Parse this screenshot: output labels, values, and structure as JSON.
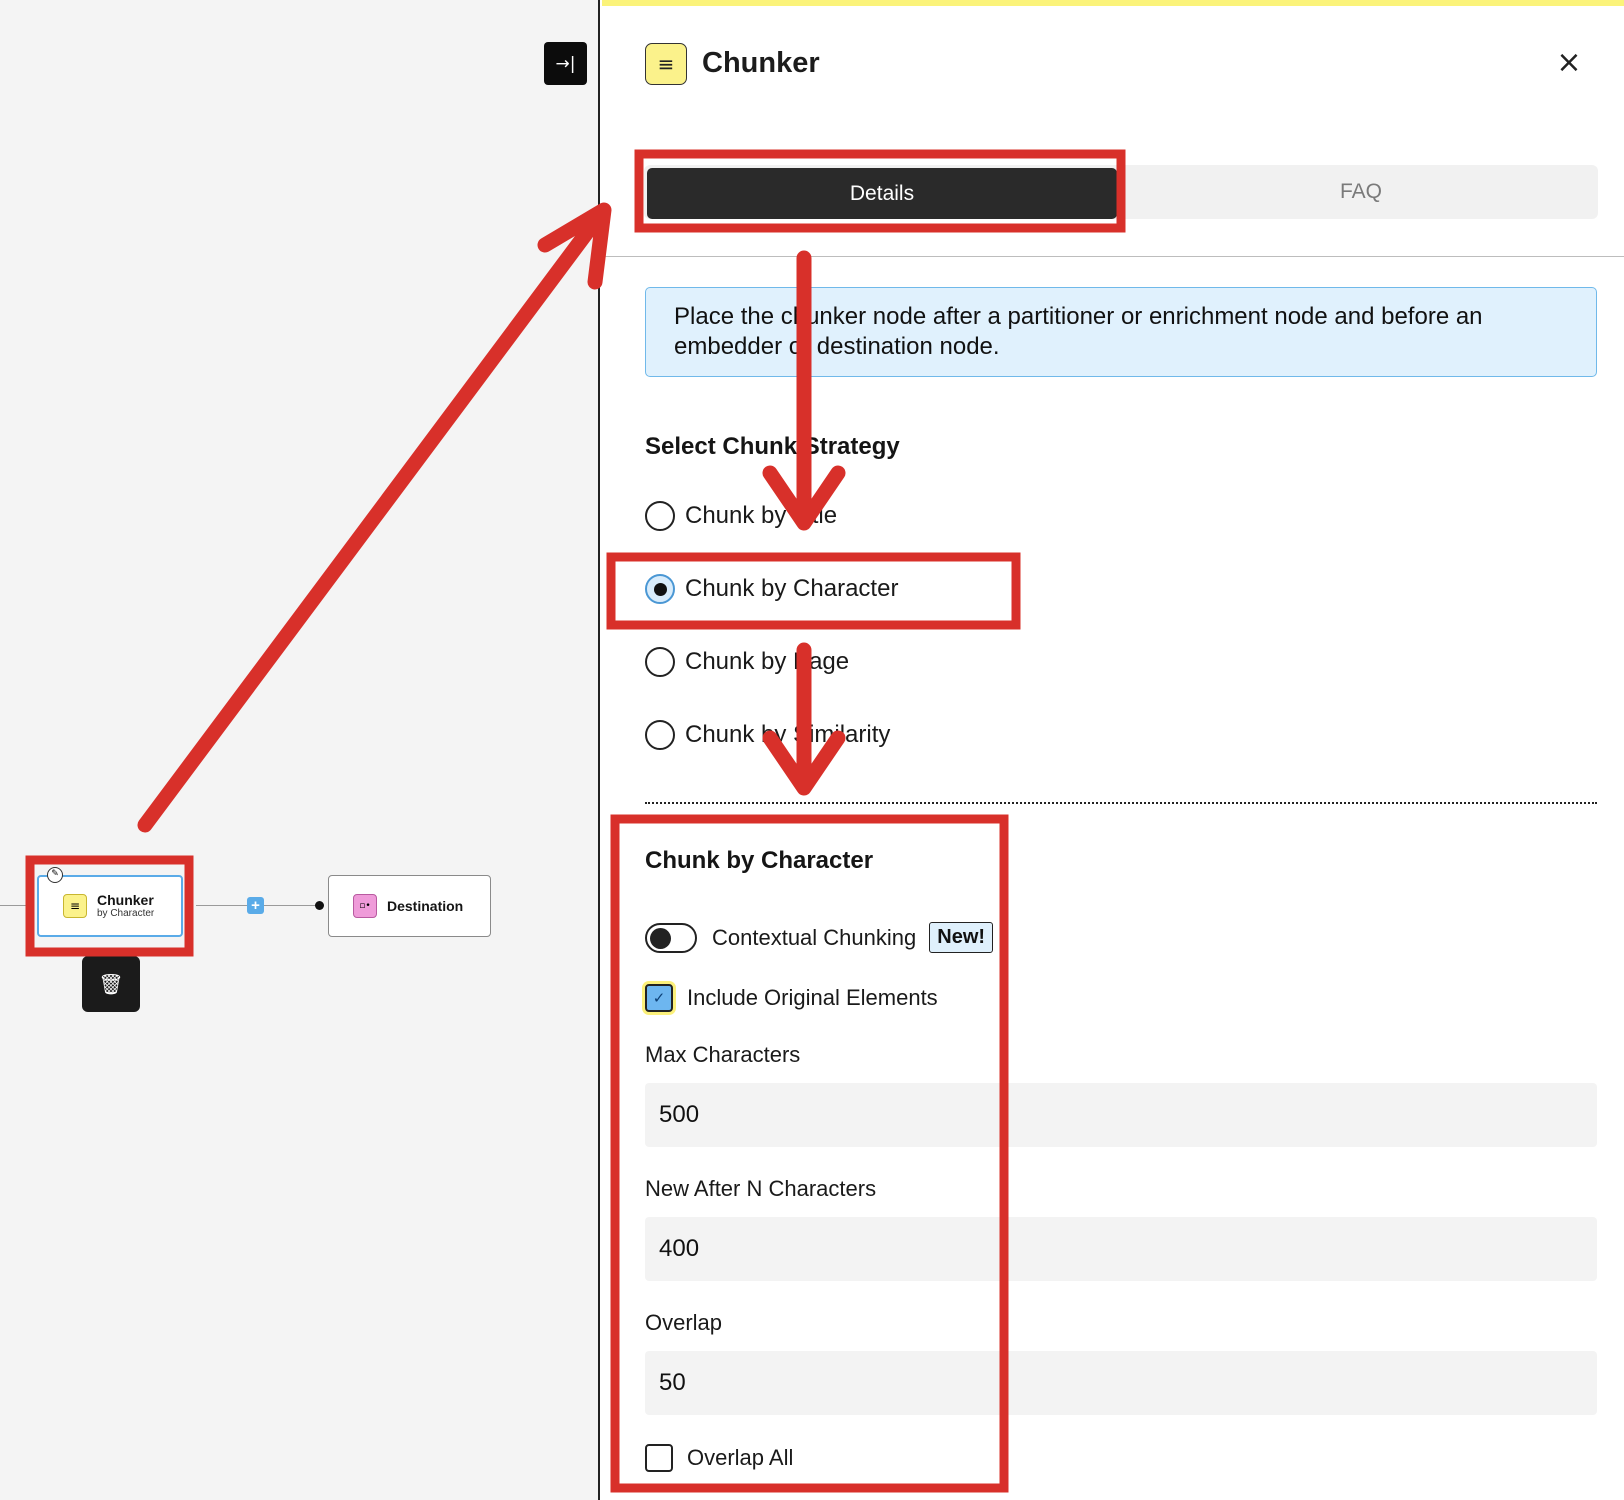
{
  "canvas": {
    "collapse_icon": "collapse-right-icon",
    "nodes": {
      "chunker": {
        "title": "Chunker",
        "subtitle": "by Character",
        "icon": "list-icon"
      },
      "destination": {
        "title": "Destination",
        "icon": "destination-icon"
      }
    },
    "add_label": "+",
    "trash_icon": "trash-icon"
  },
  "panel": {
    "title": "Chunker",
    "icon": "list-icon",
    "close_icon": "close-icon",
    "tabs": [
      {
        "label": "Details",
        "active": true
      },
      {
        "label": "FAQ",
        "active": false
      }
    ],
    "info": "Place the chunker node after a partitioner or enrichment node and before an embedder or destination node.",
    "strategy_heading": "Select Chunk Strategy",
    "strategies": [
      {
        "label": "Chunk by Title",
        "selected": false
      },
      {
        "label": "Chunk by Character",
        "selected": true
      },
      {
        "label": "Chunk by Page",
        "selected": false
      },
      {
        "label": "Chunk by Similarity",
        "selected": false
      }
    ],
    "settings": {
      "heading": "Chunk by Character",
      "contextual_chunking": {
        "label": "Contextual Chunking",
        "badge": "New!",
        "enabled": false
      },
      "include_original": {
        "label": "Include Original Elements",
        "checked": true
      },
      "max_characters": {
        "label": "Max Characters",
        "value": "500"
      },
      "new_after": {
        "label": "New After N Characters",
        "value": "400"
      },
      "overlap": {
        "label": "Overlap",
        "value": "50"
      },
      "overlap_all": {
        "label": "Overlap All",
        "checked": false
      }
    }
  },
  "colors": {
    "annotation": "#d8302a",
    "accent_blue": "#5aabe8",
    "yellow": "#fbf28b",
    "tab_active": "#2a2a2a"
  }
}
